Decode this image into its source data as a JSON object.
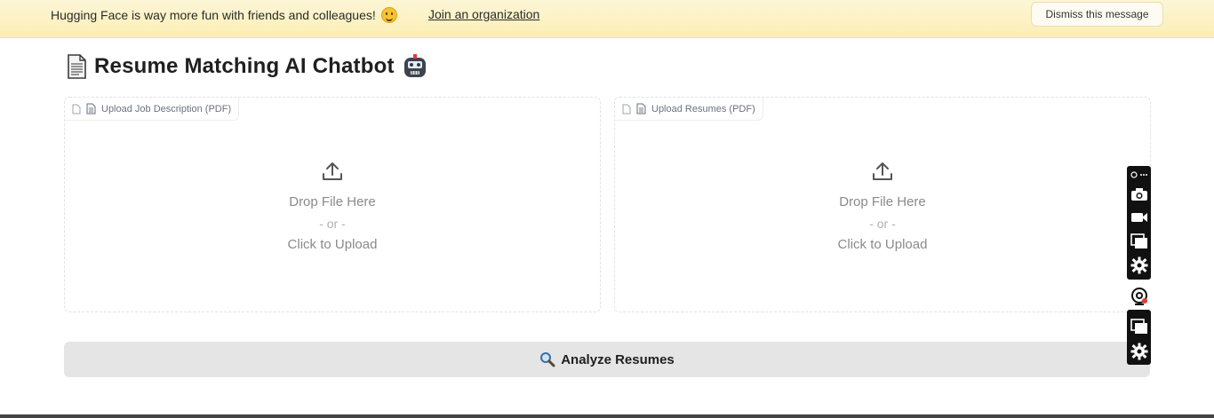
{
  "banner": {
    "message": "Hugging Face is way more fun with friends and colleagues!",
    "emoji_icon": "hugging-face-emoji-icon",
    "link_label": "Join an organization",
    "dismiss_label": "Dismiss this message"
  },
  "app": {
    "title": "Resume Matching AI Chatbot",
    "title_icon_left": "page-document-icon",
    "title_icon_right": "robot-face-icon"
  },
  "uploads": [
    {
      "label": "Upload Job Description (PDF)",
      "drop_text": "Drop File Here",
      "or_text": "- or -",
      "click_text": "Click to Upload"
    },
    {
      "label": "Upload Resumes (PDF)",
      "drop_text": "Drop File Here",
      "or_text": "- or -",
      "click_text": "Click to Upload"
    }
  ],
  "analyze_button": {
    "label": "Analyze Resumes",
    "icon": "magnifier-icon"
  },
  "floating_toolbar": {
    "buttons": [
      "link-more-icon",
      "camera-icon",
      "video-camera-icon",
      "window-copy-icon",
      "gear-icon",
      "webcam-icon",
      "window-copy-icon",
      "gear-icon"
    ]
  },
  "colors": {
    "banner_bg": "#fbeeb4",
    "button_bg": "#e5e5e5",
    "toolbar_bg": "#111111"
  }
}
